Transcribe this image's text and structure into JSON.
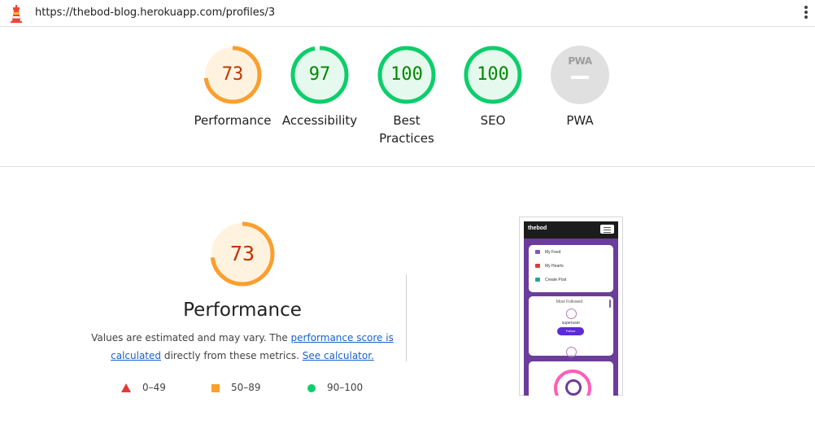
{
  "url": "https://thebod-blog.herokuapp.com/profiles/3",
  "colors": {
    "fail": "#e53935",
    "average": "#fa9f2e",
    "pass": "#0cce6b",
    "average_text": "#c33300",
    "pass_text": "#008800"
  },
  "categories": [
    {
      "id": "performance",
      "score": "73",
      "label": "Performance",
      "status": "average",
      "value": 0.73
    },
    {
      "id": "accessibility",
      "score": "97",
      "label": "Accessibility",
      "status": "pass",
      "value": 0.97
    },
    {
      "id": "best-practices",
      "score": "100",
      "label": "Best Practices",
      "status": "pass",
      "value": 1.0
    },
    {
      "id": "seo",
      "score": "100",
      "label": "SEO",
      "status": "pass",
      "value": 1.0
    },
    {
      "id": "pwa",
      "score": "PWA",
      "label": "PWA",
      "status": "na"
    }
  ],
  "performance": {
    "score": "73",
    "value": 0.73,
    "title": "Performance",
    "desc_prefix": "Values are estimated and may vary. The ",
    "desc_link1": "performance score is calculated",
    "desc_mid": " directly from these metrics. ",
    "desc_link2": "See calculator.",
    "legend": [
      {
        "range": "0–49",
        "icon": "triangle-icon"
      },
      {
        "range": "50–89",
        "icon": "square-icon"
      },
      {
        "range": "90–100",
        "icon": "circle-icon"
      }
    ]
  },
  "screenshot": {
    "brand": "thebod",
    "menu": [
      {
        "label": "My Feed",
        "icon": "feed-icon",
        "color": "#7e57c2"
      },
      {
        "label": "My Hearts",
        "icon": "heart-icon",
        "color": "#e53935"
      },
      {
        "label": "Create Post",
        "icon": "post-icon",
        "color": "#26a69a"
      }
    ],
    "most_followed": "Most Followed",
    "user": "superuser",
    "follow_label": "Follow"
  }
}
